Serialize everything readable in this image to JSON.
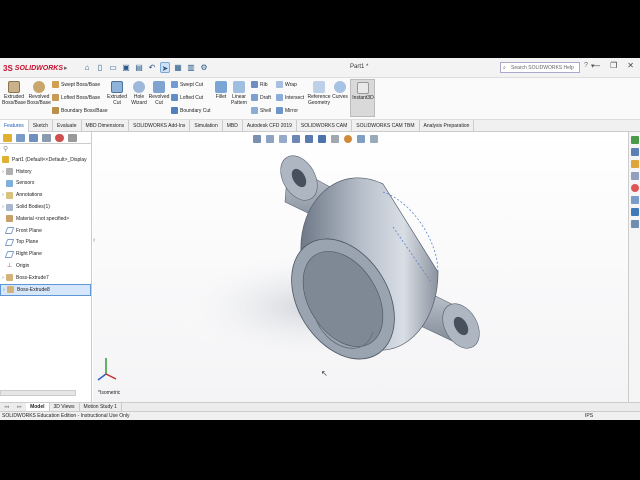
{
  "app": {
    "logo_ds": "3S",
    "logo_name": "SOLIDWORKS",
    "document_title": "Part1 *"
  },
  "help_search": {
    "placeholder": "Search SOLIDWORKS Help"
  },
  "ribbon": {
    "extruded_boss": "Extruded Boss/Base",
    "revolved_boss": "Revolved Boss/Base",
    "swept_boss": "Swept Boss/Base",
    "lofted_boss": "Lofted Boss/Base",
    "boundary_boss": "Boundary Boss/Base",
    "extruded_cut": "Extruded Cut",
    "hole_wizard": "Hole Wizard",
    "revolved_cut": "Revolved Cut",
    "swept_cut": "Swept Cut",
    "lofted_cut": "Lofted Cut",
    "boundary_cut": "Boundary Cut",
    "fillet": "Fillet",
    "linear_pattern": "Linear Pattern",
    "rib": "Rib",
    "draft": "Draft",
    "shell": "Shell",
    "wrap": "Wrap",
    "intersect": "Intersect",
    "mirror": "Mirror",
    "reference_geometry": "Reference Geometry",
    "curves": "Curves",
    "instant3d": "Instant3D"
  },
  "command_tabs": [
    "Features",
    "Sketch",
    "Evaluate",
    "MBD Dimensions",
    "SOLIDWORKS Add-Ins",
    "Simulation",
    "MBD",
    "Autodesk CFD 2019",
    "SOLIDWORKS CAM",
    "SOLIDWORKS CAM TBM",
    "Analysis Preparation"
  ],
  "tree": {
    "root": "Part1 (Default<<Default>_Display",
    "history": "History",
    "sensors": "Sensors",
    "annotations": "Annotations",
    "solid_bodies": "Solid Bodies(1)",
    "material": "Material <not specified>",
    "front_plane": "Front Plane",
    "top_plane": "Top Plane",
    "right_plane": "Right Plane",
    "origin": "Origin",
    "boss_extrude7": "Boss-Extrude7",
    "boss_extrude8": "Boss-Extrude8"
  },
  "viewport": {
    "view_label": "*Isometric"
  },
  "bottom_tabs": [
    "Model",
    "3D Views",
    "Motion Study 1"
  ],
  "status": {
    "edition": "SOLIDWORKS Education Edition - Instructional Use Only",
    "units": "IPS"
  },
  "colors": {
    "accent": "#1a56b6",
    "brand": "#c8102e",
    "selection": "#d7e7fb"
  }
}
